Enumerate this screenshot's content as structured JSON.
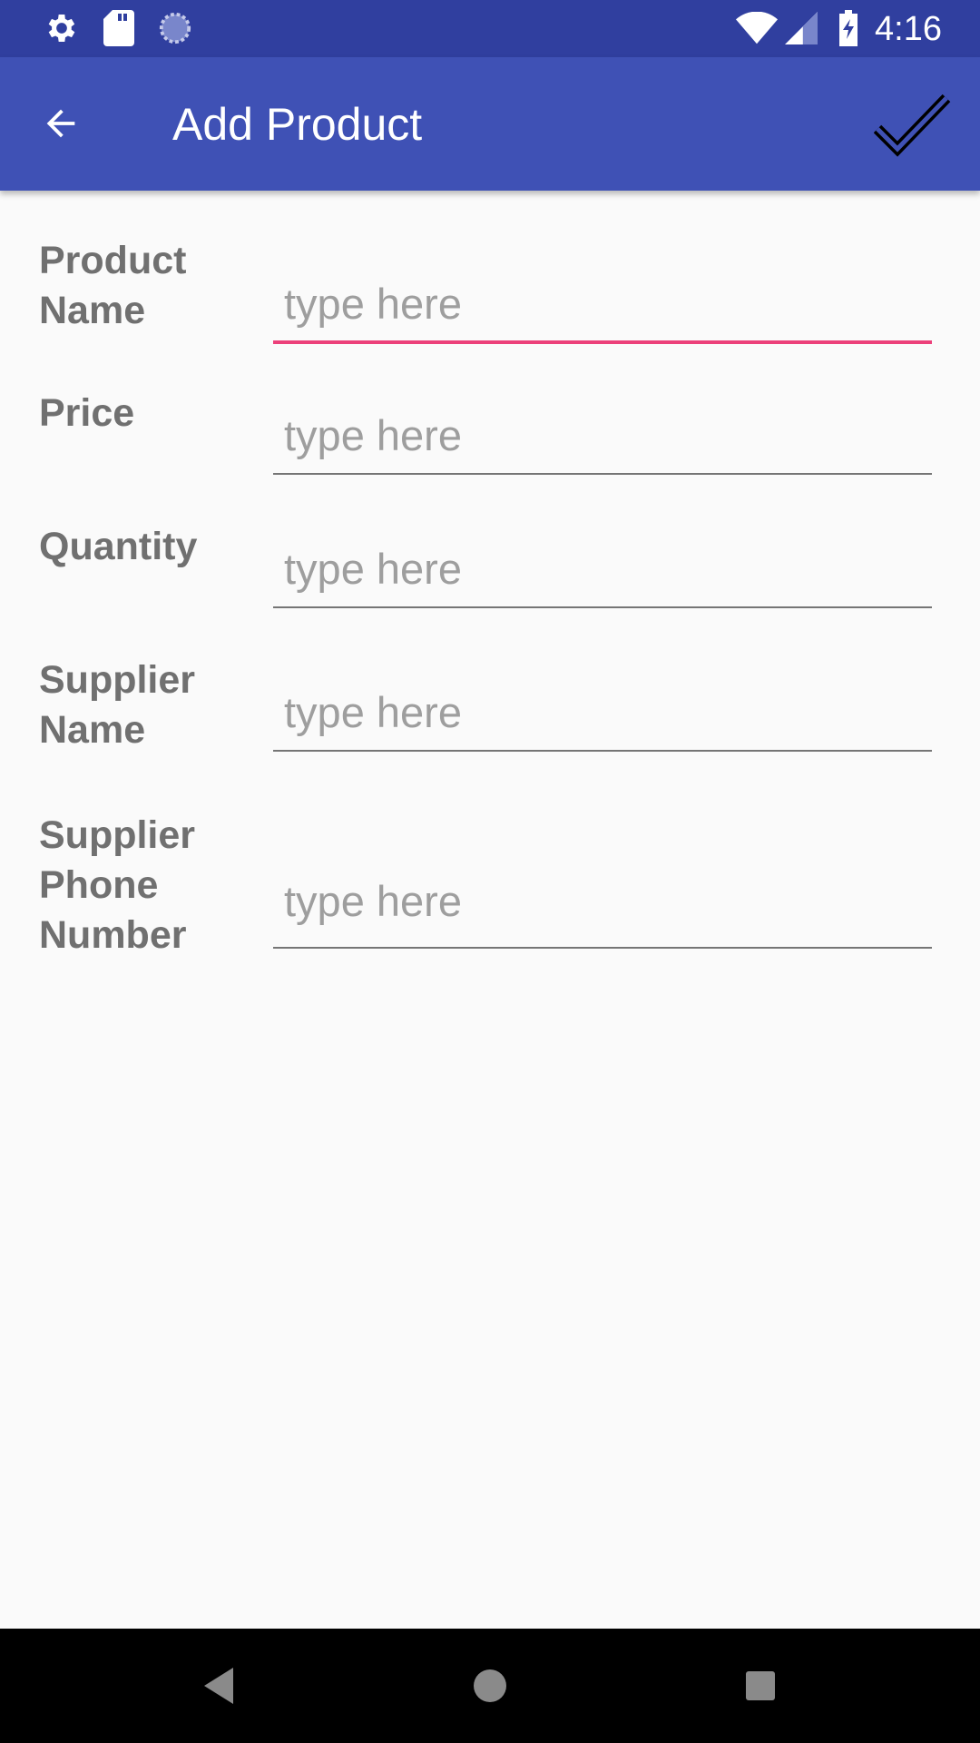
{
  "status_bar": {
    "time": "4:16",
    "left_icons": [
      "gear-icon",
      "sd-card-icon",
      "sync-icon"
    ],
    "right_icons": [
      "wifi-icon",
      "signal-icon",
      "battery-charging-icon"
    ]
  },
  "app_bar": {
    "title": "Add Product",
    "back_icon": "arrow-back-icon",
    "action_icon": "checkmark-icon"
  },
  "form": {
    "fields": [
      {
        "label": "Product Name",
        "placeholder": "type here",
        "value": "",
        "focused": true
      },
      {
        "label": "Price",
        "placeholder": "type here",
        "value": "",
        "focused": false
      },
      {
        "label": "Quantity",
        "placeholder": "type here",
        "value": "",
        "focused": false
      },
      {
        "label": "Supplier Name",
        "placeholder": "type here",
        "value": "",
        "focused": false
      },
      {
        "label": "Supplier Phone Number",
        "placeholder": "type here",
        "value": "",
        "focused": false
      }
    ]
  },
  "nav_bar": {
    "buttons": [
      "back-triangle-icon",
      "home-circle-icon",
      "recents-square-icon"
    ]
  },
  "colors": {
    "status_bar": "#303f9f",
    "app_bar": "#3f51b5",
    "accent": "#ec407a",
    "background": "#fafafa",
    "label": "#707070"
  }
}
